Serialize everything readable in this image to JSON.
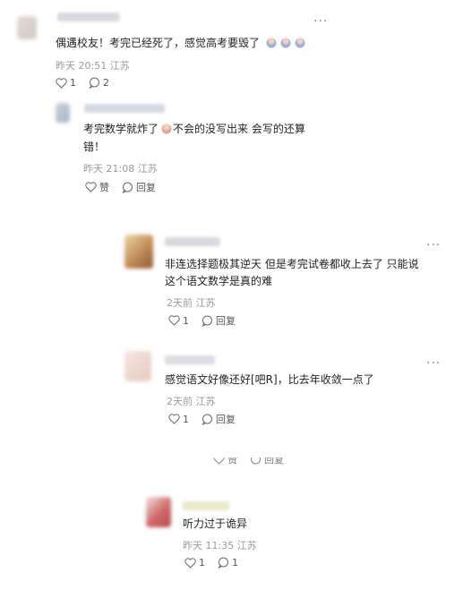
{
  "comments": [
    {
      "text": "偶遇校友！考完已经死了，感觉高考要毁了",
      "meta": "昨天 20:51 江苏",
      "like_count": "1",
      "reply_count": "2"
    },
    {
      "text_part1": "考完数学就炸了",
      "text_part2": "不会的没写出来 会写的还算",
      "text_line2": "错！",
      "meta": "昨天 21:08 江苏",
      "like_label": "赞",
      "reply_label": "回复"
    },
    {
      "line1": "非连选择题极其逆天 但是考完试卷都收上去了 只能说",
      "line2": "这个语文数学是真的难",
      "meta": "2天前 江苏",
      "like_count": "1",
      "reply_label": "回复"
    },
    {
      "text": "感觉语文好像还好[吧R]，比去年收敛一点了",
      "meta": "2天前 江苏",
      "like_count": "1",
      "reply_label": "回复"
    },
    {
      "partial_like": "赞",
      "partial_reply": "回复"
    },
    {
      "text": "听力过于诡异",
      "meta": "昨天 11:35 江苏",
      "like_count": "1",
      "reply_count": "1"
    }
  ],
  "more_label": "···"
}
